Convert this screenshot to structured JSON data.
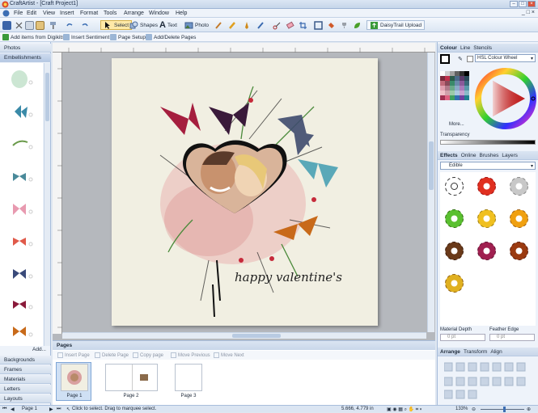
{
  "window": {
    "title": "CraftArtist - [Craft Project1]"
  },
  "menu": [
    "File",
    "Edit",
    "View",
    "Insert",
    "Format",
    "Tools",
    "Arrange",
    "Window",
    "Help"
  ],
  "toolbar": {
    "select": "Select",
    "shapes": "Shapes",
    "text": "Text",
    "photo": "Photo",
    "upload": "DaisyTrail Upload"
  },
  "subbar": {
    "add_items": "Add items from Digikits",
    "insert_sentiment": "Insert Sentiment",
    "page_setup": "Page Setup",
    "add_delete": "Add/Delete Pages"
  },
  "left_panel": {
    "tabs_top": [
      "Photos",
      "Embellishments"
    ],
    "add_label": "Add...",
    "tabs_bottom": [
      "Backgrounds",
      "Frames",
      "Materials",
      "Letters",
      "Layouts"
    ]
  },
  "canvas": {
    "caption": "happy valentine's"
  },
  "pages": {
    "header": "Pages",
    "buttons": [
      "Insert Page",
      "Delete Page",
      "Copy page",
      "Move Previous",
      "Move Next"
    ],
    "items": [
      "Page 1",
      "Page 2",
      "Page 3"
    ]
  },
  "right_panel": {
    "colour_tabs": [
      "Colour",
      "Line",
      "Stencils"
    ],
    "colour_mode": "HSL Colour Wheel",
    "more_label": "More...",
    "transparency_label": "Transparency",
    "effects_tabs": [
      "Effects",
      "Online",
      "Brushes",
      "Layers"
    ],
    "effects_category": "Edible",
    "material_depth_label": "Material Depth",
    "material_depth_value": "0 pt",
    "feather_edge_label": "Feather Edge",
    "feather_edge_value": "0 pt",
    "arrange_tabs": [
      "Arrange",
      "Transform",
      "Align"
    ]
  },
  "status": {
    "page": "Page 1",
    "hint": "Click to select. Drag to marquee select.",
    "coords": "5.666, 4.779 in",
    "zoom": "133%"
  },
  "colors": {
    "accent": "#3b6db3",
    "panel": "#eef3fa",
    "page_bg": "#f1efe2"
  }
}
